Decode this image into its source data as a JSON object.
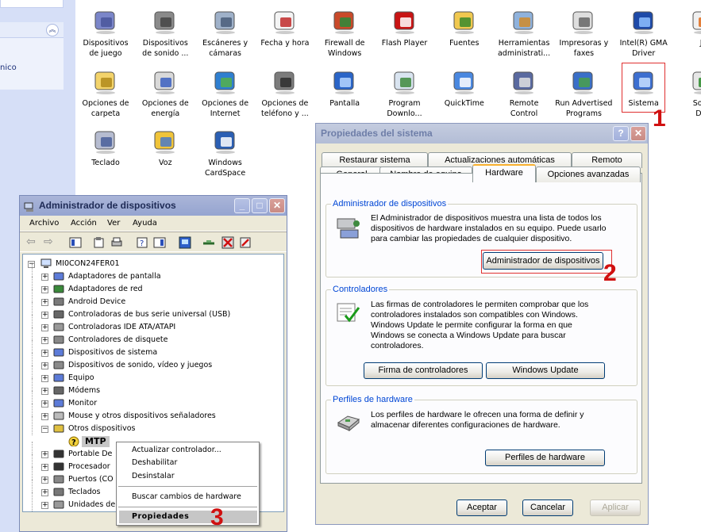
{
  "control_panel": {
    "side_text": "nico",
    "row1": [
      {
        "label": "Dispositivos\nde juego",
        "icon": "game-controller-icon"
      },
      {
        "label": "Dispositivos\nde sonido ...",
        "icon": "speaker-icon"
      },
      {
        "label": "Escáneres y\ncámaras",
        "icon": "scanner-camera-icon"
      },
      {
        "label": "Fecha y hora",
        "icon": "calendar-clock-icon"
      },
      {
        "label": "Firewall de\nWindows",
        "icon": "firewall-icon"
      },
      {
        "label": "Flash Player",
        "icon": "flash-icon"
      },
      {
        "label": "Fuentes",
        "icon": "fonts-folder-icon"
      },
      {
        "label": "Herramientas\nadministrati...",
        "icon": "admin-tools-icon"
      },
      {
        "label": "Impresoras y\nfaxes",
        "icon": "printer-icon"
      },
      {
        "label": "Intel(R) GMA\nDriver",
        "icon": "intel-gma-icon"
      },
      {
        "label": "Ja",
        "icon": "java-icon"
      }
    ],
    "row2": [
      {
        "label": "Opciones de\ncarpeta",
        "icon": "folder-options-icon"
      },
      {
        "label": "Opciones de\nenergía",
        "icon": "power-plug-icon"
      },
      {
        "label": "Opciones de\nInternet",
        "icon": "globe-icon"
      },
      {
        "label": "Opciones de\nteléfono y ...",
        "icon": "phone-icon"
      },
      {
        "label": "Pantalla",
        "icon": "display-icon"
      },
      {
        "label": "Program\nDownlo...",
        "icon": "program-download-icon"
      },
      {
        "label": "QuickTime",
        "icon": "quicktime-icon"
      },
      {
        "label": "Remote\nControl",
        "icon": "remote-control-icon"
      },
      {
        "label": "Run Advertised\nPrograms",
        "icon": "run-advertised-icon"
      },
      {
        "label": "Sistema",
        "icon": "system-icon"
      },
      {
        "label": "Softw\nDire",
        "icon": "software-icon"
      }
    ],
    "row3": [
      {
        "label": "Teclado",
        "icon": "keyboard-icon"
      },
      {
        "label": "Voz",
        "icon": "voice-icon"
      },
      {
        "label": "Windows\nCardSpace",
        "icon": "cardspace-icon"
      }
    ]
  },
  "steps": {
    "one": "1",
    "two": "2",
    "three": "3"
  },
  "device_manager": {
    "title": "Administrador de dispositivos",
    "menu": [
      "Archivo",
      "Acción",
      "Ver",
      "Ayuda"
    ],
    "root": "MI0CON24FER01",
    "tree": [
      "Adaptadores de pantalla",
      "Adaptadores de red",
      "Android Device",
      "Controladoras de bus serie universal (USB)",
      "Controladoras IDE ATA/ATAPI",
      "Controladores de disquete",
      "Dispositivos de sistema",
      "Dispositivos de sonido, vídeo y juegos",
      "Equipo",
      "Módems",
      "Monitor",
      "Mouse y otros dispositivos señaladores",
      "Otros dispositivos",
      "MTP",
      "Portable De",
      "Procesador",
      "Puertos (CO",
      "Teclados",
      "Unidades de"
    ],
    "context_menu": [
      "Actualizar controlador...",
      "Deshabilitar",
      "Desinstalar",
      "Buscar cambios de hardware",
      "Propiedades"
    ]
  },
  "system_properties": {
    "title": "Propiedades del sistema",
    "tabs_row1": [
      "Restaurar sistema",
      "Actualizaciones automáticas",
      "Remoto"
    ],
    "tabs_row2": [
      "General",
      "Nombre de equipo",
      "Hardware",
      "Opciones avanzadas"
    ],
    "device_manager_group": {
      "title": "Administrador de dispositivos",
      "text": "El Administrador de dispositivos muestra una lista de todos los dispositivos de hardware instalados en su equipo. Puede usarlo para cambiar las propiedades de cualquier dispositivo.",
      "button": "Administrador de dispositivos"
    },
    "drivers_group": {
      "title": "Controladores",
      "text": "Las firmas de controladores le permiten comprobar que los controladores instalados son compatibles con Windows. Windows Update le permite configurar la forma en que Windows se conecta a Windows Update para buscar controladores.",
      "button1": "Firma de controladores",
      "button2": "Windows Update"
    },
    "profiles_group": {
      "title": "Perfiles de hardware",
      "text": "Los perfiles de hardware le ofrecen una forma de definir y almacenar diferentes configuraciones de hardware.",
      "button": "Perfiles de hardware"
    },
    "buttons": {
      "ok": "Aceptar",
      "cancel": "Cancelar",
      "apply": "Aplicar"
    }
  }
}
